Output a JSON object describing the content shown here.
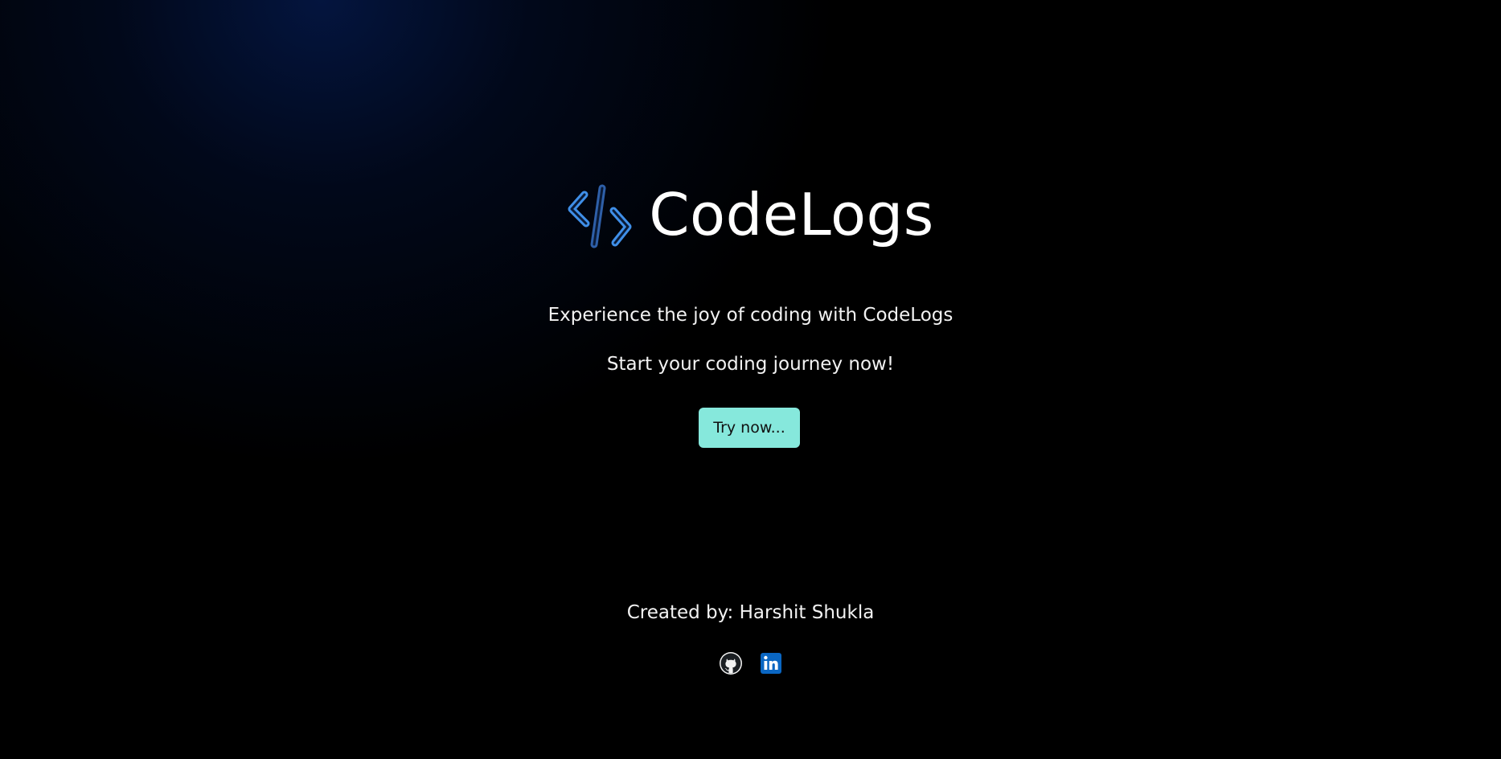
{
  "brand": {
    "name": "CodeLogs",
    "logo_icon": "code-brackets-icon"
  },
  "hero": {
    "tagline": "Experience the joy of coding with CodeLogs",
    "subtagline": "Start your coding journey now!",
    "cta_label": "Try now..."
  },
  "footer": {
    "credit": "Created by: Harshit Shukla",
    "socials": [
      {
        "name": "GitHub",
        "icon": "github-icon"
      },
      {
        "name": "LinkedIn",
        "icon": "linkedin-icon"
      }
    ]
  },
  "colors": {
    "background": "#000000",
    "glow": "#041642",
    "accent_button": "#86e8dc",
    "logo_blue": "#3f8fe8",
    "logo_slash": "#2e5fa8",
    "linkedin_blue": "#0a66c2"
  }
}
